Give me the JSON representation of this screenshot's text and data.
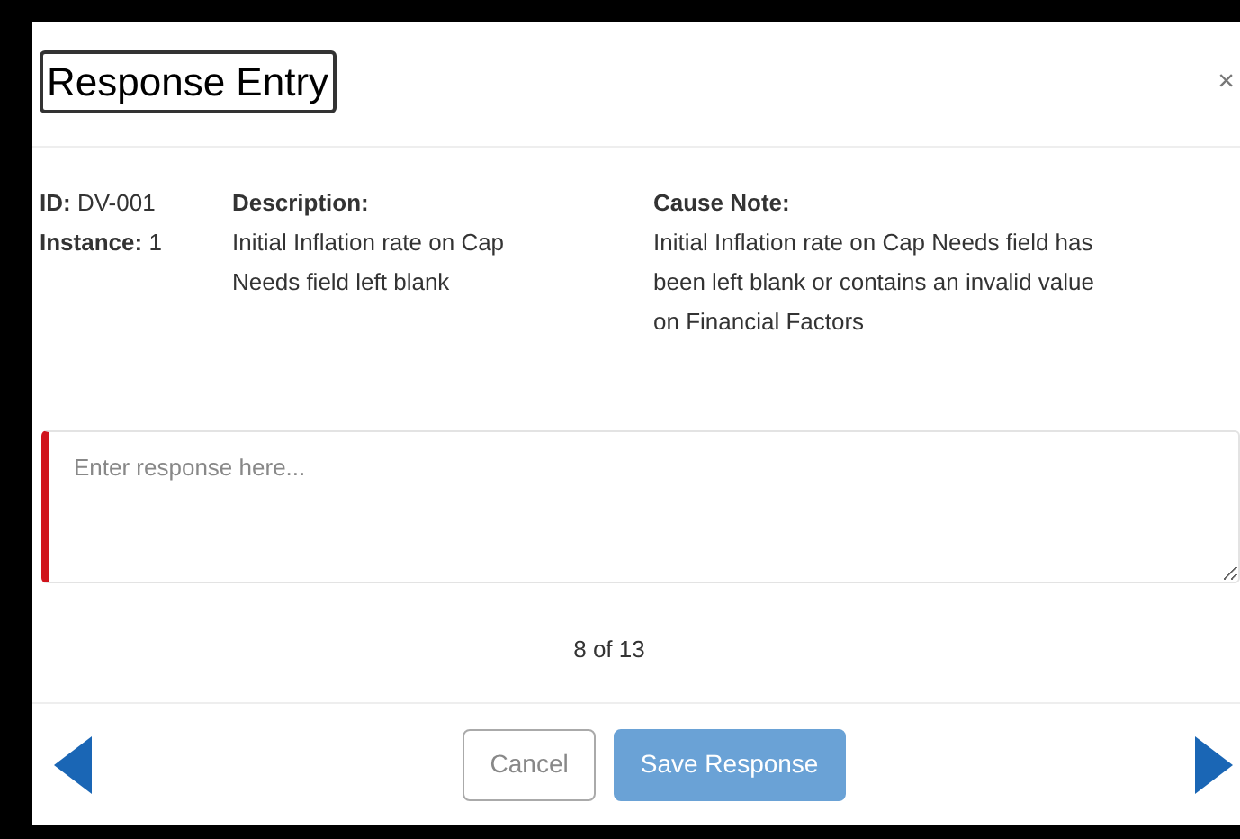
{
  "dialog": {
    "title": "Response Entry",
    "close": "×"
  },
  "details": {
    "id_label": "ID:",
    "id_value": "DV-001",
    "instance_label": "Instance:",
    "instance_value": "1",
    "description_label": "Description:",
    "description": "Initial Inflation rate on Cap Needs field left blank",
    "cause_label": "Cause Note:",
    "cause": "Initial Inflation rate on Cap Needs field has been left blank or contains an invalid value on Financial Factors"
  },
  "response": {
    "placeholder": "Enter response here...",
    "required": true
  },
  "pager": "8 of 13",
  "buttons": [
    {
      "label": "Cancel",
      "kind": "secondary",
      "disabled": false
    },
    {
      "label": "Save Response",
      "kind": "primary",
      "disabled": true
    }
  ]
}
